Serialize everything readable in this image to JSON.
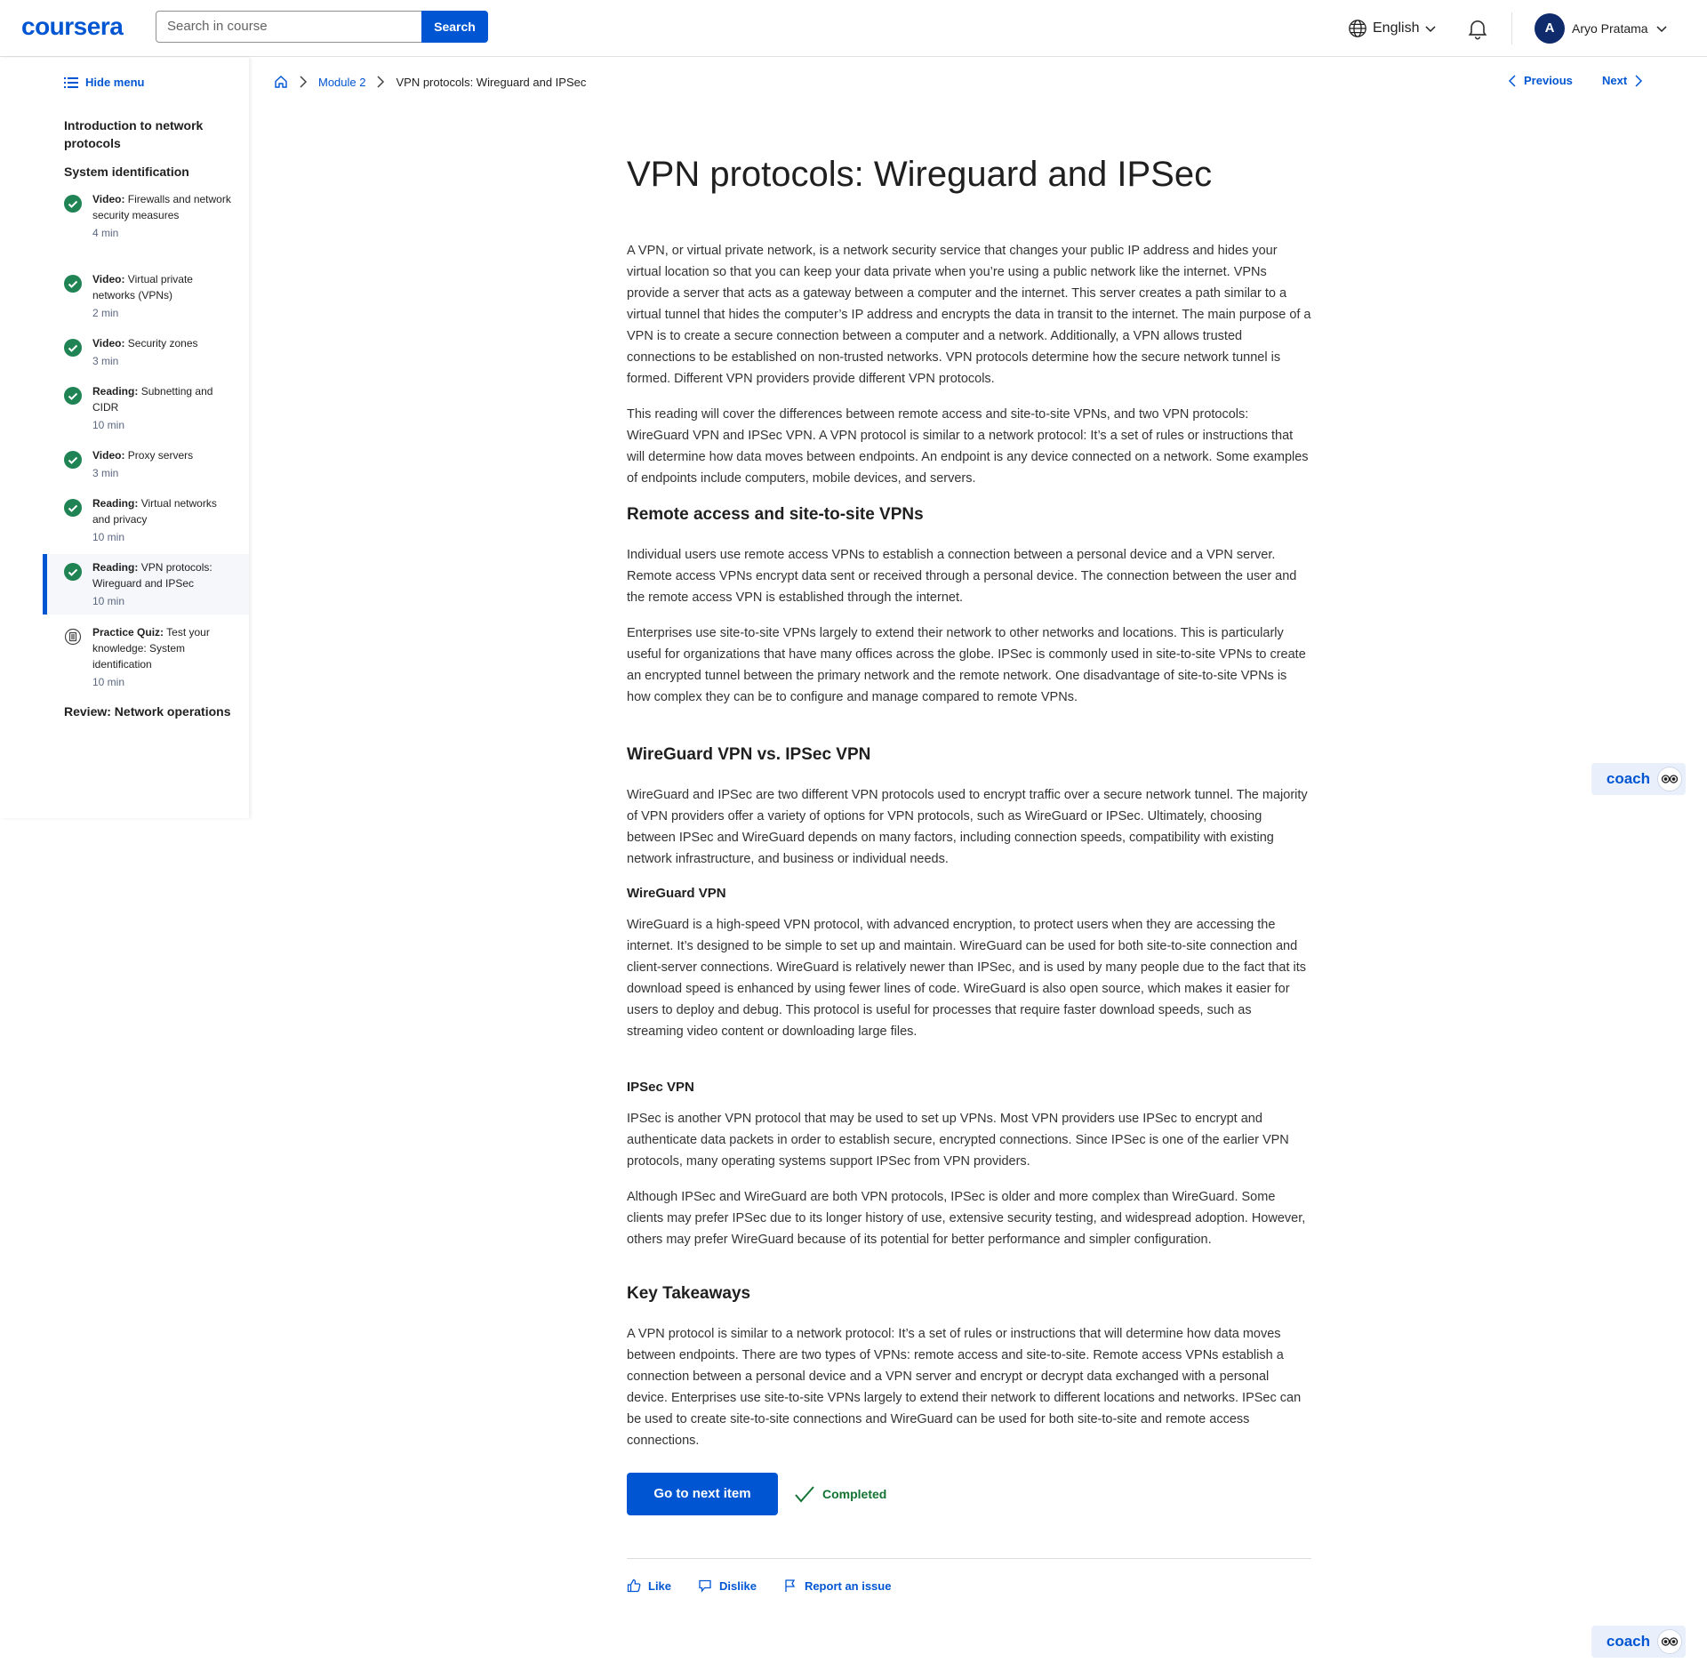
{
  "header": {
    "logo": "coursera",
    "search_placeholder": "Search in course",
    "search_button": "Search",
    "language": "English",
    "user_initial": "A",
    "user_name": "Aryo Pratama"
  },
  "sidebar": {
    "hide_menu": "Hide menu",
    "sections": [
      "Introduction to network protocols",
      "System identification",
      "Review: Network operations"
    ],
    "items": [
      {
        "type": "Video:",
        "title": "Firewalls and network security measures",
        "duration": "4 min",
        "status": "completed"
      },
      {
        "type": "Video:",
        "title": "Virtual private networks (VPNs)",
        "duration": "2 min",
        "status": "completed"
      },
      {
        "type": "Video:",
        "title": "Security zones",
        "duration": "3 min",
        "status": "completed"
      },
      {
        "type": "Reading:",
        "title": "Subnetting and CIDR",
        "duration": "10 min",
        "status": "completed"
      },
      {
        "type": "Video:",
        "title": "Proxy servers",
        "duration": "3 min",
        "status": "completed"
      },
      {
        "type": "Reading:",
        "title": "Virtual networks and privacy",
        "duration": "10 min",
        "status": "completed"
      },
      {
        "type": "Reading:",
        "title": "VPN protocols: Wireguard and IPSec",
        "duration": "10 min",
        "status": "completed"
      },
      {
        "type": "Practice Quiz:",
        "title": "Test your knowledge: System identification",
        "duration": "10 min",
        "status": "quiz"
      }
    ]
  },
  "breadcrumb": {
    "module": "Module 2",
    "current": "VPN protocols: Wireguard and IPSec"
  },
  "nav": {
    "previous": "Previous",
    "next": "Next"
  },
  "article": {
    "title": "VPN protocols: Wireguard and IPSec",
    "p1": "A VPN, or virtual private network, is a network security service that changes your public IP address and hides your virtual location so that you can keep your data private when you’re using a public network like the internet. VPNs provide a server that acts as a gateway between a computer and the internet. This server creates a path similar to a virtual tunnel that hides the computer’s IP address and encrypts the data in transit to the internet. The main purpose of a VPN is to create a secure connection between a computer and a network. Additionally, a VPN allows trusted connections to be established on non-trusted networks. VPN protocols determine how the secure network tunnel is formed. Different VPN providers provide different VPN protocols.",
    "p2": "This reading will cover the differences between remote access and site-to-site VPNs, and two VPN protocols: WireGuard VPN and IPSec VPN. A VPN protocol is similar to a network protocol: It’s a set of rules or instructions that will determine how data moves between endpoints. An endpoint is any device connected on a network. Some examples of endpoints include computers, mobile devices, and servers.",
    "h_remote": "Remote access and site-to-site VPNs",
    "p3": "Individual users use remote access VPNs to establish a connection between a personal device and a VPN server. Remote access VPNs encrypt data sent or received through a personal device. The connection between the user and the remote access VPN is established through the internet.",
    "p4": "Enterprises use site-to-site VPNs largely to extend their network to other networks and locations. This is particularly useful for organizations that have many offices across the globe. IPSec is commonly used in site-to-site VPNs to create an encrypted tunnel between the primary network and the remote network. One disadvantage of site-to-site VPNs is how complex they can be to configure and manage compared to remote VPNs.",
    "h_vs": "WireGuard VPN vs. IPSec VPN",
    "p5": "WireGuard and IPSec are two different VPN protocols used to encrypt traffic over a secure network tunnel. The majority of VPN providers offer a variety of options for VPN protocols, such as WireGuard or IPSec. Ultimately, choosing between IPSec and WireGuard depends on many factors, including connection speeds, compatibility with existing network infrastructure, and business or individual needs.",
    "h_wireguard": "WireGuard VPN",
    "p6": "WireGuard is a high-speed VPN protocol, with advanced encryption, to protect users when they are accessing the internet. It’s designed to be simple to set up and maintain. WireGuard can be used for both site-to-site connection and client-server connections. WireGuard is relatively newer than IPSec, and is used by many people due to the fact that its download speed is enhanced by using fewer lines of code. WireGuard is also open source, which makes it easier for users to deploy and debug. This protocol is useful for processes that require faster download speeds, such as streaming video content or downloading large files.",
    "h_ipsec": "IPSec VPN",
    "p7": "IPSec is another VPN protocol that may be used to set up VPNs. Most VPN providers use IPSec to encrypt and authenticate data packets in order to establish secure, encrypted connections. Since IPSec is one of the earlier VPN protocols, many operating systems support IPSec from VPN providers.",
    "p8": "Although IPSec and WireGuard are both VPN protocols, IPSec is older and more complex than WireGuard. Some clients may prefer IPSec due to its longer history of use, extensive security testing, and widespread adoption. However, others may prefer WireGuard because of its potential for better performance and simpler configuration.",
    "h_key": "Key Takeaways",
    "p9": "A VPN protocol is similar to a network protocol: It’s a set of rules or instructions that will determine how data moves between endpoints. There are two types of VPNs: remote access and site-to-site. Remote access VPNs establish a connection between a personal device and a VPN server and encrypt or decrypt data exchanged with a personal device. Enterprises use site-to-site VPNs largely to extend their network to different locations and networks. IPSec can be used to create site-to-site connections and WireGuard can be used for both site-to-site and remote access connections."
  },
  "actions": {
    "next_item": "Go to next item",
    "completed": "Completed"
  },
  "feedback": {
    "like": "Like",
    "dislike": "Dislike",
    "report": "Report an issue"
  },
  "coach": {
    "label": "coach"
  },
  "colors": {
    "accent": "#0056d2",
    "completed_green": "#137333",
    "check_green": "#1f8354"
  }
}
